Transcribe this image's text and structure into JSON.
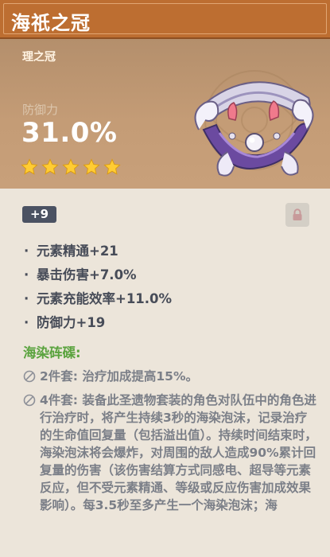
{
  "header": {
    "title": "海祇之冠"
  },
  "artifact": {
    "slot": "理之冠",
    "main_stat": {
      "label": "防御力",
      "value": "31.0%"
    },
    "rarity": 5
  },
  "details": {
    "level": "+9",
    "substats": [
      {
        "bullet": "·",
        "text": "元素精通+21"
      },
      {
        "bullet": "·",
        "text": "暴击伤害+7.0%"
      },
      {
        "bullet": "·",
        "text": "元素充能效率+11.0%"
      },
      {
        "bullet": "·",
        "text": "防御力+19"
      }
    ],
    "set_name": "海染砗磲:",
    "set_effects": [
      {
        "label": "2件套: ",
        "text": "治疗加成提高15%。"
      },
      {
        "label": "4件套: ",
        "text": "装备此圣遗物套装的角色对队伍中的角色进行治疗时，将产生持续3秒的海染泡沫，记录治疗的生命值回复量（包括溢出值）。持续时间结束时，海染泡沫将会爆炸，对周围的敌人造成90%累计回复量的伤害（该伤害结算方式同感电、超导等元素反应，但不受元素精通、等级或反应伤害加成效果影响）。每3.5秒至多产生一个海染泡沫；海"
      }
    ]
  }
}
